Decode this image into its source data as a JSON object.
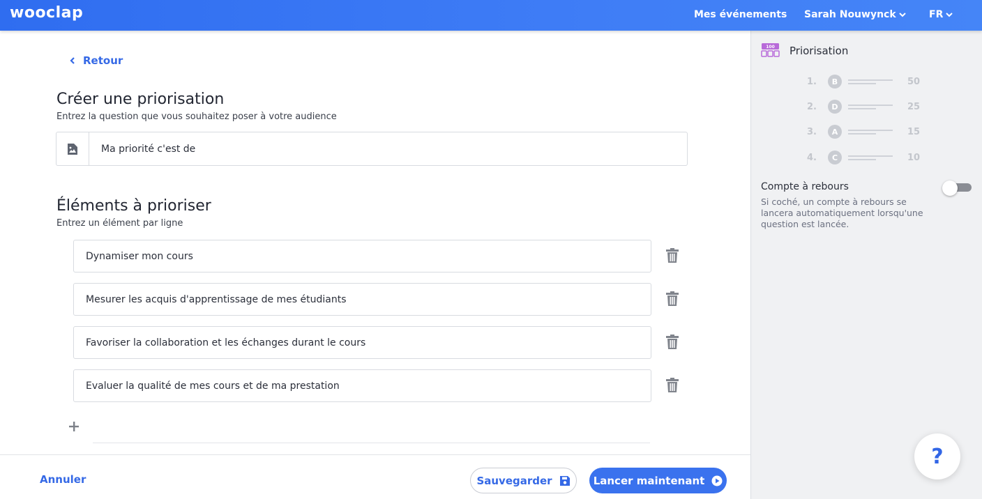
{
  "header": {
    "logo": "wooclap",
    "nav_events": "Mes événements",
    "user": "Sarah Nouwynck",
    "lang": "FR"
  },
  "main": {
    "back_label": "Retour",
    "create_title": "Créer une priorisation",
    "create_subtitle": "Entrez la question que vous souhaitez poser à votre audience",
    "question_value": "Ma priorité c'est de",
    "items_title": "Éléments à prioriser",
    "items_subtitle": "Entrez un élément par ligne",
    "items": [
      "Dynamiser mon cours",
      "Mesurer les acquis d'apprentissage de mes étudiants",
      "Favoriser la collaboration et les échanges durant le cours",
      "Evaluer la qualité de mes cours et de ma prestation"
    ]
  },
  "footer": {
    "cancel_label": "Annuler",
    "save_label": "Sauvegarder",
    "launch_label": "Lancer maintenant"
  },
  "side": {
    "title": "Priorisation",
    "icon_badge": "100",
    "ranks": [
      {
        "num": "1.",
        "letter": "B",
        "score": "50"
      },
      {
        "num": "2.",
        "letter": "D",
        "score": "25"
      },
      {
        "num": "3.",
        "letter": "A",
        "score": "15"
      },
      {
        "num": "4.",
        "letter": "C",
        "score": "10"
      }
    ],
    "countdown_title": "Compte à rebours",
    "countdown_desc": "Si coché, un compte à rebours se lancera automatiquement lorsqu'une question est lancée.",
    "countdown_enabled": false
  },
  "help_label": "?",
  "colors": {
    "brand": "#3a72ee",
    "link": "#3569e6",
    "panel_bg": "#f0f1f3"
  }
}
